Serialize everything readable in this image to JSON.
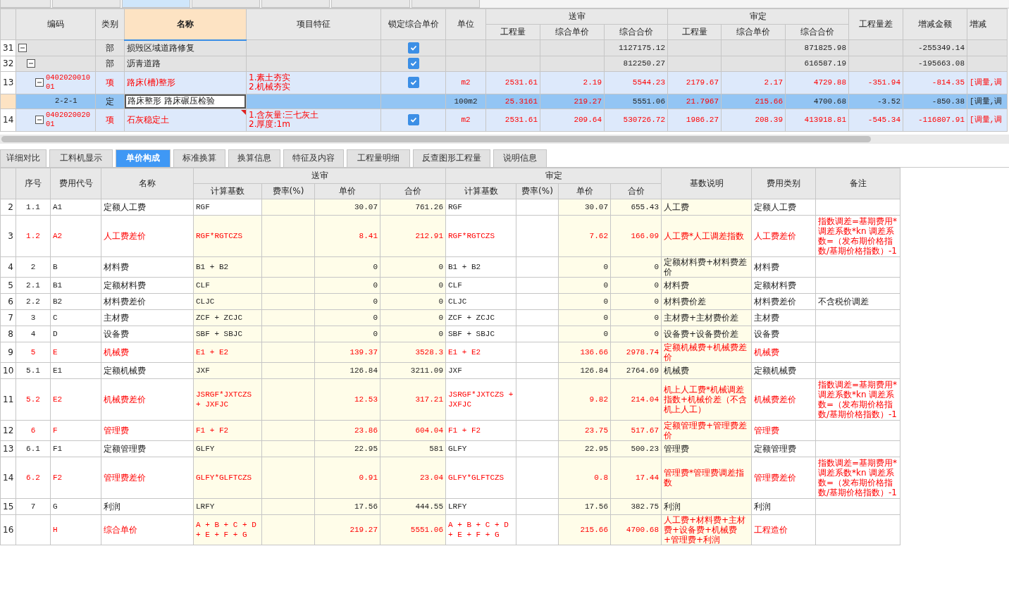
{
  "top_tabs": [
    {
      "selected": false
    },
    {
      "selected": false
    },
    {
      "selected": true
    },
    {
      "selected": false
    },
    {
      "selected": false
    },
    {
      "selected": false
    },
    {
      "selected": false
    }
  ],
  "top_grid": {
    "header": {
      "left": [
        {
          "label": "编码",
          "selected": false
        },
        {
          "label": "类别",
          "selected": false
        },
        {
          "label": "名称",
          "selected": true
        },
        {
          "label": "项目特征",
          "selected": false
        },
        {
          "label": "锁定综合单价",
          "selected": false
        },
        {
          "label": "单位",
          "selected": false
        }
      ],
      "groups": [
        {
          "label": "送审",
          "columns": [
            "工程量",
            "综合单价",
            "综合合价"
          ]
        },
        {
          "label": "审定",
          "columns": [
            "工程量",
            "综合单价",
            "综合合价"
          ]
        }
      ],
      "right": [
        "工程量差",
        "增减金额",
        "增减"
      ]
    },
    "rows": [
      {
        "num": "31",
        "kind": "section",
        "type": "部",
        "name": "损毁区域道路修复",
        "locked": true,
        "expanded": true,
        "selected": false,
        "values": {
          "sub_total": {
            "text": "1127175.12",
            "red": false
          },
          "apr_total": {
            "text": "871825.98",
            "red": false
          },
          "amount_diff": {
            "text": "-255349.14",
            "red": false
          }
        },
        "children": [
          {
            "num": "32",
            "kind": "section",
            "type": "部",
            "name": "沥青道路",
            "locked": true,
            "expanded": true,
            "selected": false,
            "values": {
              "sub_total": {
                "text": "812250.27",
                "red": false
              },
              "apr_total": {
                "text": "616587.19",
                "red": false
              },
              "amount_diff": {
                "text": "-195663.08",
                "red": false
              }
            },
            "children": [
              {
                "num": "13",
                "kind": "item",
                "code": "040202001001",
                "type": "项",
                "name": "路床(槽)整形",
                "features": [
                  "1.素土夯实",
                  "2.机械夯实"
                ],
                "locked": true,
                "unit": "m2",
                "expanded": true,
                "selected": false,
                "values": {
                  "sub_qty": {
                    "text": "2531.61",
                    "red": true
                  },
                  "sub_price": {
                    "text": "2.19",
                    "red": true
                  },
                  "sub_total": {
                    "text": "5544.23",
                    "red": true
                  },
                  "apr_qty": {
                    "text": "2179.67",
                    "red": true
                  },
                  "apr_price": {
                    "text": "2.17",
                    "red": true
                  },
                  "apr_total": {
                    "text": "4729.88",
                    "red": true
                  },
                  "qty_diff": {
                    "text": "-351.94",
                    "red": true
                  },
                  "amount_diff": {
                    "text": "-814.35",
                    "red": true
                  },
                  "column_last": {
                    "text": "[调量,调",
                    "red": true
                  }
                },
                "children": [
                  {
                    "kind": "quota",
                    "code": "2-2-1",
                    "type": "定",
                    "name": "路床整形 路床碾压检验",
                    "editing": true,
                    "unit": "100m2",
                    "selected": true,
                    "values": {
                      "sub_qty": {
                        "text": "25.3161",
                        "red": true
                      },
                      "sub_price": {
                        "text": "219.27",
                        "red": true
                      },
                      "sub_total": {
                        "text": "5551.06",
                        "red": false
                      },
                      "apr_qty": {
                        "text": "21.7967",
                        "red": true
                      },
                      "apr_price": {
                        "text": "215.66",
                        "red": true
                      },
                      "apr_total": {
                        "text": "4700.68",
                        "red": false
                      },
                      "qty_diff": {
                        "text": "-3.52",
                        "red": false
                      },
                      "amount_diff": {
                        "text": "-850.38",
                        "red": false
                      },
                      "column_last": {
                        "text": "[调量,调",
                        "red": false
                      }
                    }
                  }
                ]
              },
              {
                "num": "14",
                "kind": "item",
                "code": "040202002001",
                "type": "项",
                "name": "石灰稳定土",
                "comment": true,
                "features": [
                  "1.含灰量:三七灰土",
                  "2.厚度:1m"
                ],
                "locked": true,
                "unit": "m2",
                "expanded": true,
                "selected": false,
                "values": {
                  "sub_qty": {
                    "text": "2531.61",
                    "red": true
                  },
                  "sub_price": {
                    "text": "209.64",
                    "red": true
                  },
                  "sub_total": {
                    "text": "530726.72",
                    "red": true
                  },
                  "apr_qty": {
                    "text": "1986.27",
                    "red": true
                  },
                  "apr_price": {
                    "text": "208.39",
                    "red": true
                  },
                  "apr_total": {
                    "text": "413918.81",
                    "red": true
                  },
                  "qty_diff": {
                    "text": "-545.34",
                    "red": true
                  },
                  "amount_diff": {
                    "text": "-116807.91",
                    "red": true
                  },
                  "column_last": {
                    "text": "[调量,调",
                    "red": true
                  }
                }
              }
            ]
          }
        ]
      }
    ]
  },
  "bottom_tabs": [
    {
      "label": "详细对比",
      "selected": false
    },
    {
      "label": "工料机显示",
      "selected": false
    },
    {
      "label": "单价构成",
      "selected": true
    },
    {
      "label": "标准换算",
      "selected": false
    },
    {
      "label": "换算信息",
      "selected": false
    },
    {
      "label": "特征及内容",
      "selected": false
    },
    {
      "label": "工程量明细",
      "selected": false
    },
    {
      "label": "反查图形工程量",
      "selected": false
    },
    {
      "label": "说明信息",
      "selected": false
    }
  ],
  "cost_grid": {
    "header": {
      "left": [
        "序号",
        "费用代号",
        "名称"
      ],
      "groups": [
        {
          "label": "送审",
          "columns": [
            "计算基数",
            "费率(%)",
            "单价",
            "合价"
          ]
        },
        {
          "label": "审定",
          "columns": [
            "计算基数",
            "费率(%)",
            "单价",
            "合价"
          ]
        }
      ],
      "right": [
        "基数说明",
        "费用类别",
        "备注"
      ]
    },
    "rows": [
      {
        "num": "2",
        "seq": "1.1",
        "code": "A1",
        "name": "定额人工费",
        "sub_base": "RGF",
        "sub_price": "30.07",
        "sub_total": "761.26",
        "apr_base": "RGF",
        "apr_price": "30.07",
        "apr_total": "655.43",
        "desc": "人工费",
        "category": "定额人工费",
        "red": false
      },
      {
        "num": "3",
        "seq": "1.2",
        "code": "A2",
        "name": "人工费差价",
        "sub_base": "RGF*RGTCZS",
        "sub_price": "8.41",
        "sub_total": "212.91",
        "apr_base": "RGF*RGTCZS",
        "apr_price": "7.62",
        "apr_total": "166.09",
        "desc": "人工费*人工调差指数",
        "category": "人工费差价",
        "note": "指数调差=基期费用*调差系数*kn 调差系数=（发布期价格指数/基期价格指数）-1",
        "red": true
      },
      {
        "num": "4",
        "seq": "2",
        "code": "B",
        "name": "材料费",
        "sub_base": "B1 + B2",
        "sub_price": "0",
        "sub_total": "0",
        "apr_base": "B1 + B2",
        "apr_price": "0",
        "apr_total": "0",
        "desc": "定额材料费+材料费差价",
        "category": "材料费",
        "red": false
      },
      {
        "num": "5",
        "seq": "2.1",
        "code": "B1",
        "name": "定额材料费",
        "sub_base": "CLF",
        "sub_price": "0",
        "sub_total": "0",
        "apr_base": "CLF",
        "apr_price": "0",
        "apr_total": "0",
        "desc": "材料费",
        "category": "定额材料费",
        "red": false
      },
      {
        "num": "6",
        "seq": "2.2",
        "code": "B2",
        "name": "材料费差价",
        "sub_base": "CLJC",
        "sub_price": "0",
        "sub_total": "0",
        "apr_base": "CLJC",
        "apr_price": "0",
        "apr_total": "0",
        "desc": "材料费价差",
        "category": "材料费差价",
        "note": "不含税价调差",
        "red": false
      },
      {
        "num": "7",
        "seq": "3",
        "code": "C",
        "name": "主材费",
        "sub_base": "ZCF + ZCJC",
        "sub_price": "0",
        "sub_total": "0",
        "apr_base": "ZCF + ZCJC",
        "apr_price": "0",
        "apr_total": "0",
        "desc": "主材费+主材费价差",
        "category": "主材费",
        "red": false
      },
      {
        "num": "8",
        "seq": "4",
        "code": "D",
        "name": "设备费",
        "sub_base": "SBF + SBJC",
        "sub_price": "0",
        "sub_total": "0",
        "apr_base": "SBF + SBJC",
        "apr_price": "0",
        "apr_total": "0",
        "desc": "设备费+设备费价差",
        "category": "设备费",
        "red": false
      },
      {
        "num": "9",
        "seq": "5",
        "code": "E",
        "name": "机械费",
        "sub_base": "E1 + E2",
        "sub_price": "139.37",
        "sub_total": "3528.3",
        "apr_base": "E1 + E2",
        "apr_price": "136.66",
        "apr_total": "2978.74",
        "desc": "定额机械费+机械费差价",
        "category": "机械费",
        "red": true
      },
      {
        "num": "10",
        "seq": "5.1",
        "code": "E1",
        "name": "定额机械费",
        "sub_base": "JXF",
        "sub_price": "126.84",
        "sub_total": "3211.09",
        "apr_base": "JXF",
        "apr_price": "126.84",
        "apr_total": "2764.69",
        "desc": "机械费",
        "category": "定额机械费",
        "red": false
      },
      {
        "num": "11",
        "seq": "5.2",
        "code": "E2",
        "name": "机械费差价",
        "sub_base": "JSRGF*JXTCZS + JXFJC",
        "sub_price": "12.53",
        "sub_total": "317.21",
        "apr_base": "JSRGF*JXTCZS + JXFJC",
        "apr_price": "9.82",
        "apr_total": "214.04",
        "desc": "机上人工费*机械调差指数+机械价差（不含机上人工）",
        "category": "机械费差价",
        "note": "指数调差=基期费用*调差系数*kn 调差系数=（发布期价格指数/基期价格指数）-1",
        "red": true
      },
      {
        "num": "12",
        "seq": "6",
        "code": "F",
        "name": "管理费",
        "sub_base": "F1 + F2",
        "sub_price": "23.86",
        "sub_total": "604.04",
        "apr_base": "F1 + F2",
        "apr_price": "23.75",
        "apr_total": "517.67",
        "desc": "定额管理费+管理费差价",
        "category": "管理费",
        "red": true
      },
      {
        "num": "13",
        "seq": "6.1",
        "code": "F1",
        "name": "定额管理费",
        "sub_base": "GLFY",
        "sub_price": "22.95",
        "sub_total": "581",
        "apr_base": "GLFY",
        "apr_price": "22.95",
        "apr_total": "500.23",
        "desc": "管理费",
        "category": "定额管理费",
        "red": false
      },
      {
        "num": "14",
        "seq": "6.2",
        "code": "F2",
        "name": "管理费差价",
        "sub_base": "GLFY*GLFTCZS",
        "sub_price": "0.91",
        "sub_total": "23.04",
        "apr_base": "GLFY*GLFTCZS",
        "apr_price": "0.8",
        "apr_total": "17.44",
        "desc": "管理费*管理费调差指数",
        "category": "管理费差价",
        "note": "指数调差=基期费用*调差系数*kn 调差系数=（发布期价格指数/基期价格指数）-1",
        "red": true
      },
      {
        "num": "15",
        "seq": "7",
        "code": "G",
        "name": "利润",
        "sub_base": "LRFY",
        "sub_price": "17.56",
        "sub_total": "444.55",
        "apr_base": "LRFY",
        "apr_price": "17.56",
        "apr_total": "382.75",
        "desc": "利润",
        "category": "利润",
        "red": false
      },
      {
        "num": "16",
        "code": "H",
        "name": "综合单价",
        "sub_base": "A + B + C + D + E + F + G",
        "sub_price": "219.27",
        "sub_total": "5551.06",
        "apr_base": "A + B + C + D + E + F + G",
        "apr_price": "215.66",
        "apr_total": "4700.68",
        "desc": "人工费+材料费+主材费+设备费+机械费+管理费+利润",
        "category": "工程造价",
        "red": true
      }
    ]
  }
}
